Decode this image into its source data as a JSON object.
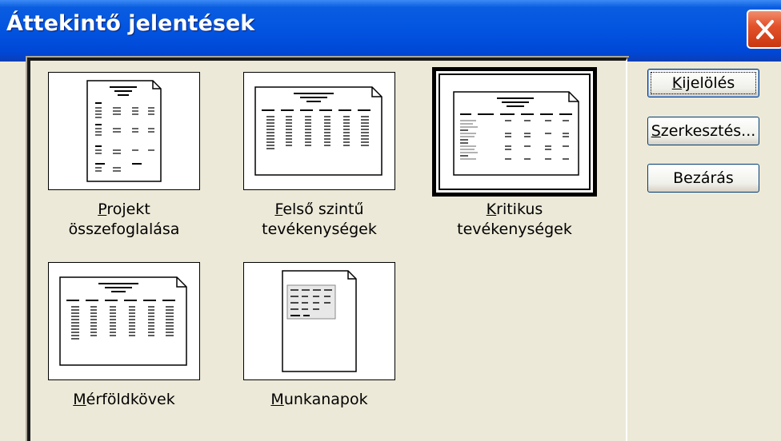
{
  "window": {
    "title": "Áttekintő jelentések",
    "close_icon": "close-icon"
  },
  "reports": [
    {
      "id": "projekt",
      "line1": "Projekt",
      "line1_hotkey": "P",
      "line1_rest": "rojekt",
      "line2": "összefoglalása",
      "selected": false,
      "thumbnail": "portrait-summary-page-icon"
    },
    {
      "id": "felso",
      "line1": "Felső szintű",
      "line1_hotkey": "F",
      "line1_rest": "első szintű",
      "line2": "tevékenységek",
      "selected": false,
      "thumbnail": "landscape-table-page-icon"
    },
    {
      "id": "kritikus",
      "line1": "Kritikus",
      "line1_hotkey": "K",
      "line1_rest": "ritikus",
      "line2": "tevékenységek",
      "selected": true,
      "thumbnail": "landscape-gray-table-page-icon"
    },
    {
      "id": "merfoldkovek",
      "line1": "Mérföldkövek",
      "line1_hotkey": "M",
      "line1_rest": "érföldkövek",
      "line2": "",
      "selected": false,
      "thumbnail": "landscape-table-page-icon"
    },
    {
      "id": "munkanapok",
      "line1": "Munkanapok",
      "line1_hotkey": "M",
      "line1_rest": "unkanapok",
      "line2": "",
      "selected": false,
      "thumbnail": "portrait-calendar-page-icon"
    }
  ],
  "buttons": {
    "select": {
      "hotkey": "K",
      "rest": "ijelölés"
    },
    "edit": {
      "hotkey": "S",
      "rest": "zerkesztés..."
    },
    "close": {
      "label": "Bezárás"
    }
  },
  "colors": {
    "titlebar": "#0054e3",
    "dialog_bg": "#ece9d8",
    "close_button": "#e4542c"
  }
}
